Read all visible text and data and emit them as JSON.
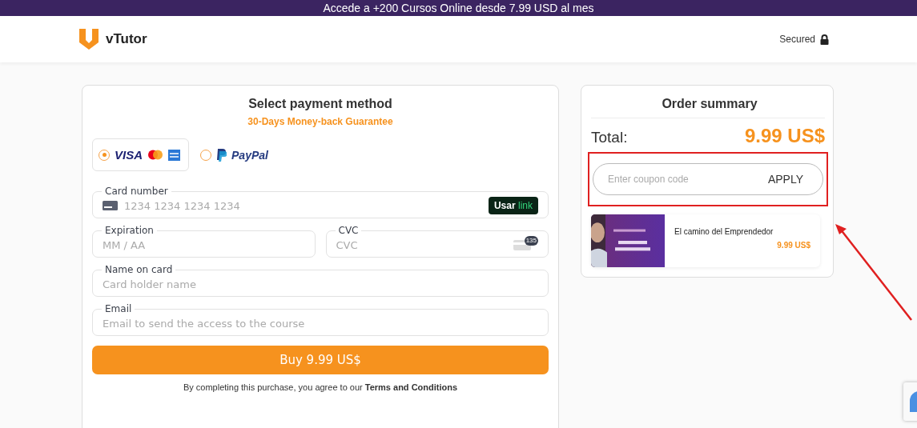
{
  "banner": {
    "text": "Accede a +200 Cursos Online desde 7.99 USD al mes"
  },
  "header": {
    "brand": "vTutor",
    "secured": "Secured"
  },
  "payment": {
    "title": "Select payment method",
    "subtitle": "30-Days Money-back Guarantee",
    "methods": [
      {
        "kind": "card",
        "label": "VISA",
        "selected": true
      },
      {
        "kind": "paypal",
        "label": "PayPal",
        "selected": false
      }
    ],
    "fields": [
      {
        "kind": "card",
        "label": "Card number",
        "placeholder": "1234 1234 1234 1234",
        "badge": [
          "Usar",
          "link"
        ]
      },
      {
        "kind": "pair",
        "items": [
          {
            "kind": "expiry",
            "label": "Expiration",
            "placeholder": "MM / AA"
          },
          {
            "kind": "cvc",
            "label": "CVC",
            "placeholder": "CVC",
            "code": "135"
          }
        ]
      },
      {
        "kind": "plain",
        "label": "Name on card",
        "placeholder": "Card holder name"
      },
      {
        "kind": "plain",
        "label": "Email",
        "placeholder": "Email to send the access to the course"
      }
    ],
    "buy": "Buy 9.99 US$",
    "terms": "By completing this purchase, you agree to our",
    "terms_link": "Terms and Conditions"
  },
  "summary": {
    "title": "Order summary",
    "total_label": "Total:",
    "total": "9.99 US$",
    "coupon_placeholder": "Enter coupon code",
    "apply": "APPLY",
    "items": [
      {
        "kind": "picture",
        "name": "El camino del Emprendedor",
        "price": "9.99 US$"
      }
    ]
  }
}
